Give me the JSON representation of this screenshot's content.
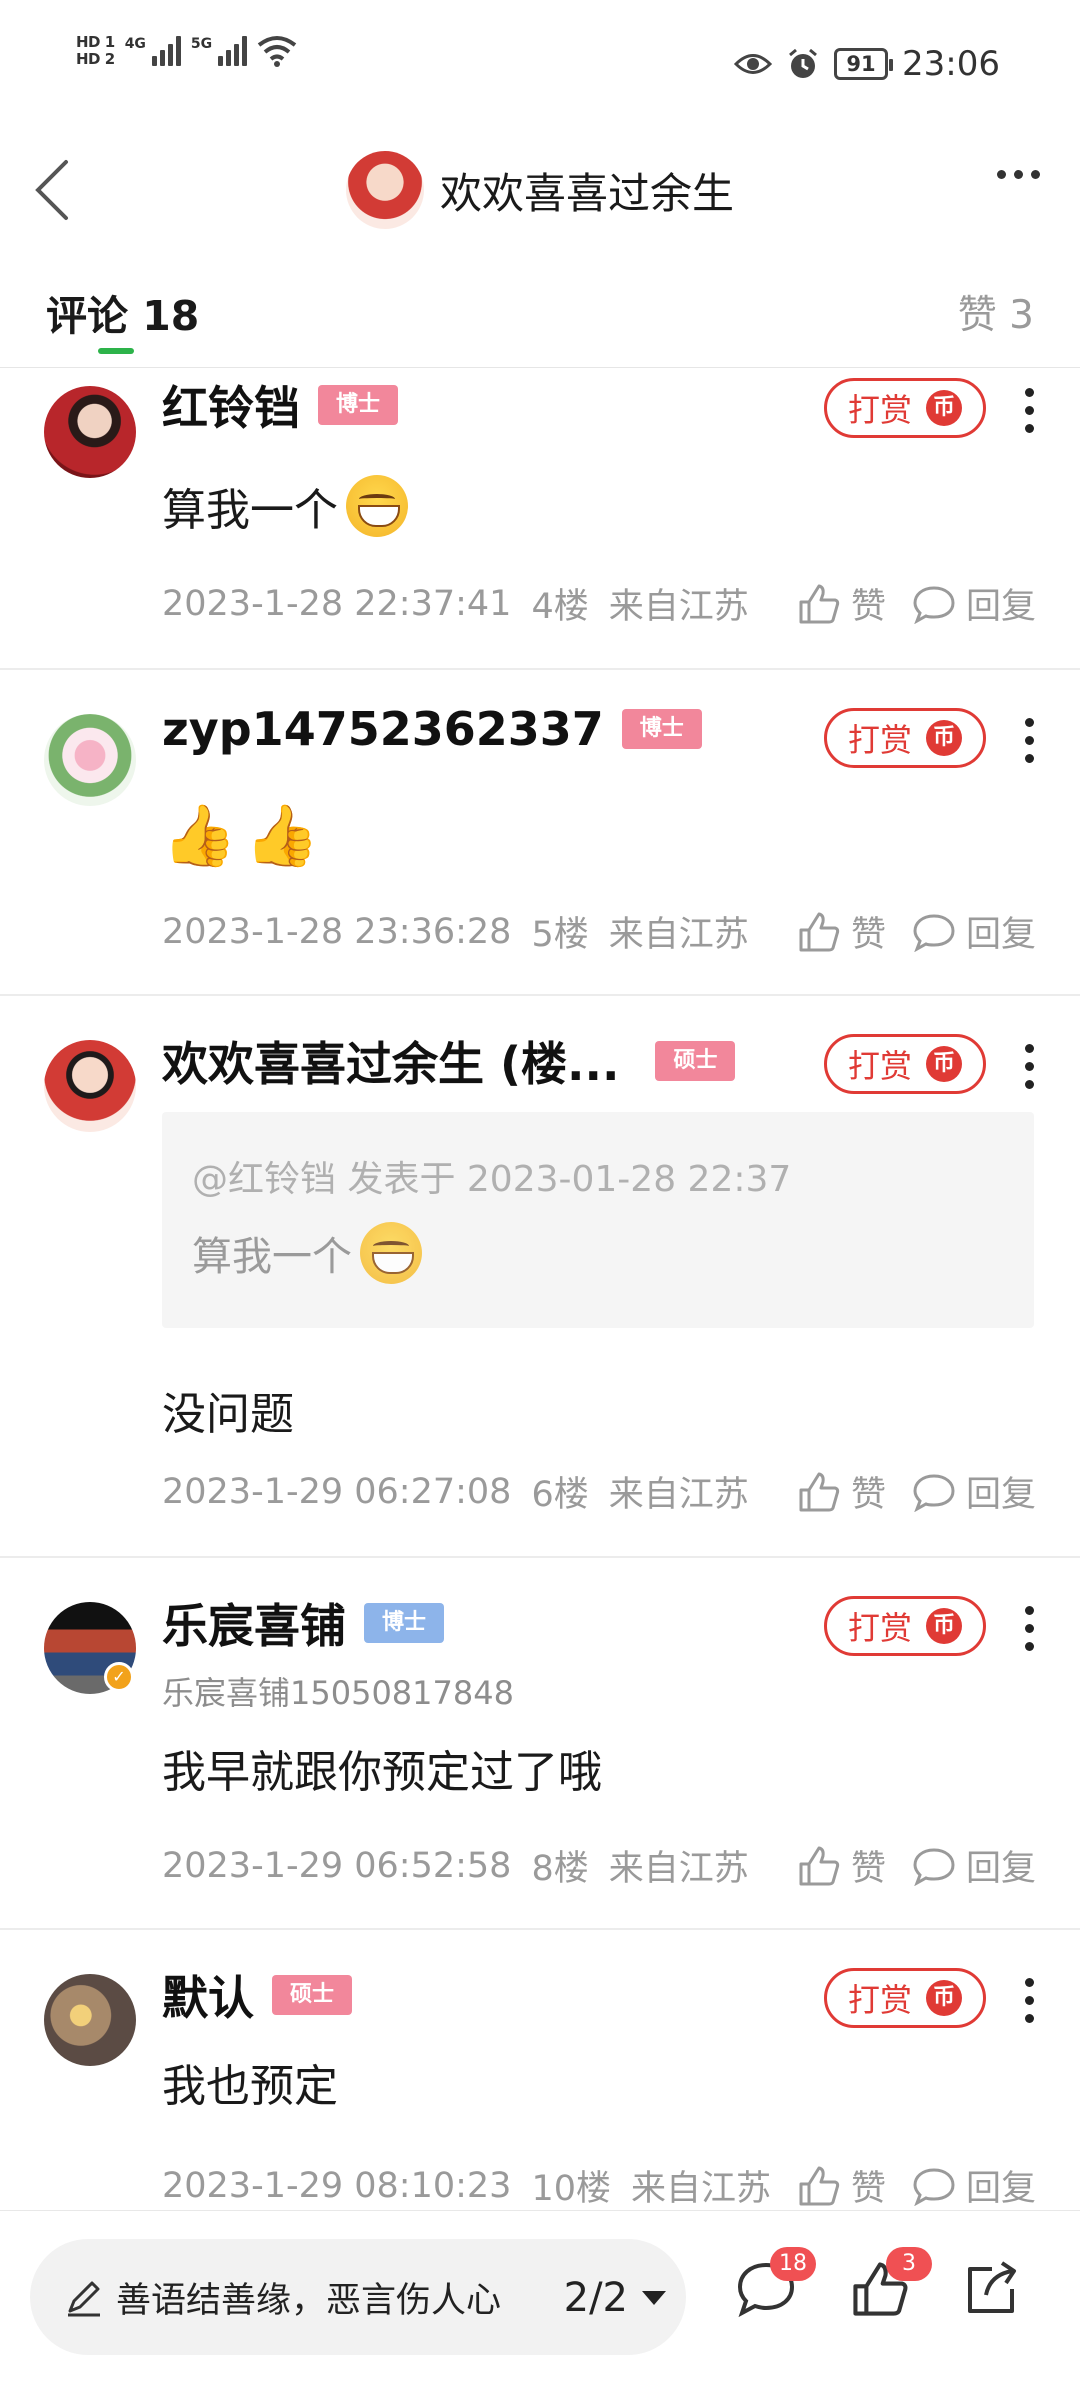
{
  "status_bar": {
    "hd1": "HD",
    "hd2": "HD",
    "net1": "4G",
    "net2": "5G",
    "battery": "91",
    "time": "23:06"
  },
  "header": {
    "title": "欢欢喜喜过余生"
  },
  "tabs": {
    "comments_label": "评论",
    "comments_count": "18",
    "likes_label": "赞",
    "likes_count": "3"
  },
  "tip_label": "打赏",
  "coin_glyph": "币",
  "like_label": "赞",
  "reply_label": "回复",
  "comments": [
    {
      "name": "红铃铛",
      "badge": "博士",
      "body": "算我一个",
      "timestamp": "2023-1-28 22:37:41",
      "floor": "4楼",
      "location": "来自江苏"
    },
    {
      "name": "zyp14752362337",
      "badge": "博士",
      "body": "",
      "timestamp": "2023-1-28 23:36:28",
      "floor": "5楼",
      "location": "来自江苏"
    },
    {
      "name": "欢欢喜喜过余生 (楼...",
      "badge": "硕士",
      "quote_meta": "@红铃铛 发表于 2023-01-28 22:37",
      "quote_body": "算我一个",
      "body": "没问题",
      "timestamp": "2023-1-29 06:27:08",
      "floor": "6楼",
      "location": "来自江苏"
    },
    {
      "name": "乐宸喜铺",
      "badge": "博士",
      "sub_name": "乐宸喜铺15050817848",
      "body": "我早就跟你预定过了哦",
      "timestamp": "2023-1-29 06:52:58",
      "floor": "8楼",
      "location": "来自江苏"
    },
    {
      "name": "默认",
      "badge": "硕士",
      "body": "我也预定",
      "timestamp": "2023-1-29 08:10:23",
      "floor": "10楼",
      "location": "来自江苏"
    }
  ],
  "bottom_bar": {
    "input_placeholder": "善语结善缘，恶言伤人心",
    "page_indicator": "2/2",
    "comment_count": "18",
    "like_count": "3"
  },
  "colors": {
    "accent_red": "#e03a35",
    "tab_underline_green": "#2db34a",
    "badge_pink": "#f2879b",
    "badge_blue": "#8db4ea",
    "count_badge": "#f05053"
  }
}
